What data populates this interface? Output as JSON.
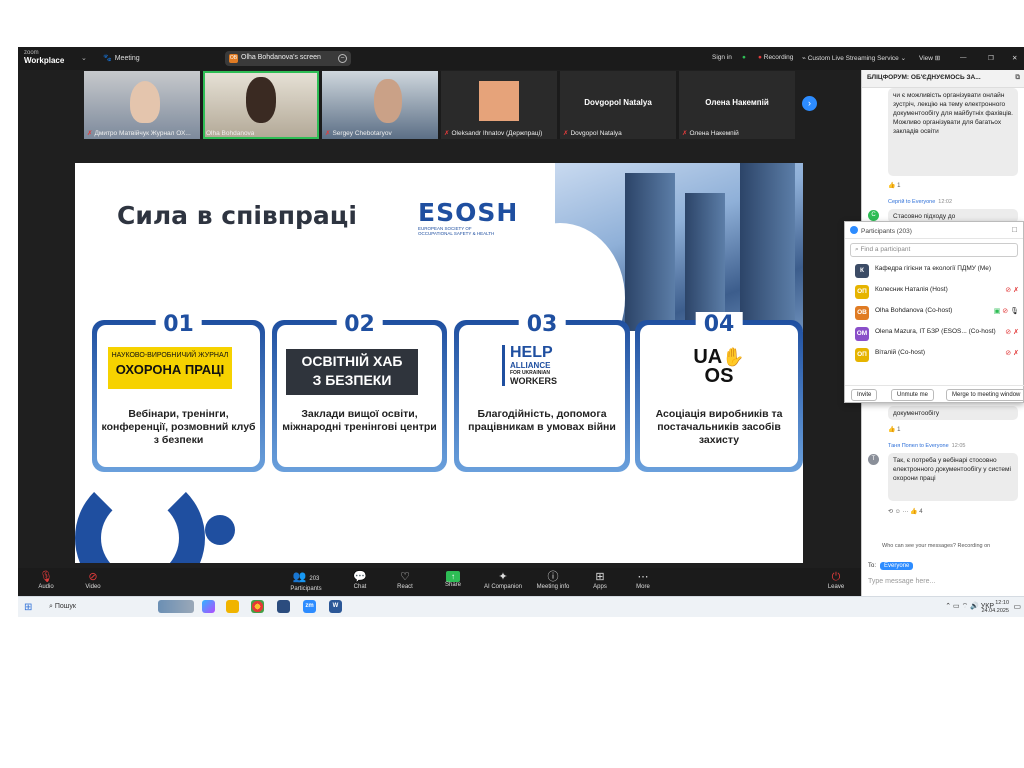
{
  "topbar": {
    "logo_line1": "zoom",
    "logo_line2": "Workplace",
    "meeting_label": "Meeting",
    "screen_avatar": "OB",
    "screen_label": "Olha Bohdanova's screen",
    "signin": "Sign in",
    "recording": "Recording",
    "streaming": "Custom Live Streaming Service",
    "view": "View"
  },
  "gallery": [
    {
      "name": "Дмитро Матвійчук Журнал ОХ...",
      "muted": true
    },
    {
      "name": "Olha Bohdanova",
      "muted": false,
      "active": true
    },
    {
      "name": "Sergey Chebotaryov",
      "muted": true
    },
    {
      "name": "Oleksandr Ihnatov (Держпраці)",
      "muted": true
    },
    {
      "name": "Dovgopol Natalya",
      "muted": true,
      "big": "Dovgopol Natalya"
    },
    {
      "name": "Олена Накемпій",
      "muted": true,
      "big": "Олена Накемпій"
    }
  ],
  "slide": {
    "title": "Сила в співпраці",
    "esosh_logo": "ESOSH",
    "esosh_sub1": "European Society of",
    "esosh_sub2": "Occupational Safety & Health",
    "cards": [
      {
        "num": "01",
        "badge_top": "НАУКОВО-ВИРОБНИЧИЙ ЖУРНАЛ",
        "badge_main": "ОХОРОНА ПРАЦІ",
        "desc": "Вебінари, тренінги, конференції, розмовний клуб з безпеки"
      },
      {
        "num": "02",
        "badge_main1": "ОСВІТНІЙ ХАБ",
        "badge_main2": "З БЕЗПЕКИ",
        "desc": "Заклади вищої освіти, міжнародні тренінгові центри"
      },
      {
        "num": "03",
        "help1": "HELP",
        "help2": "ALLIANCE",
        "help3": "FOR UKRAINIAN",
        "help4": "WORKERS",
        "desc": "Благодійність, допомога працівникам в умовах війни"
      },
      {
        "num": "04",
        "uaos1": "UA",
        "uaos2": "OS",
        "desc": "Асоціація виробників та постачальників засобів захисту"
      }
    ]
  },
  "toolbar": {
    "audio": "Audio",
    "video": "Video",
    "participants_count": "203",
    "participants": "Participants",
    "chat": "Chat",
    "react": "React",
    "share": "Share",
    "ai": "AI Companion",
    "info": "Meeting info",
    "apps": "Apps",
    "more": "More",
    "leave": "Leave"
  },
  "chat": {
    "header": "БЛІЦФОРУМ: ОБ'ЄДНУЄМОСЬ ЗА...",
    "msg1": "чи є можливість організувати онлайн зустріч, лекцію на тему електронного документообігу для майбутніх фахівців. Можливо організувати для багатьох закладів освіти",
    "react1": "👍 1",
    "sender2": "Сергій to Everyone",
    "time2": "12:02",
    "avatar2": "С",
    "msg2": "Стасовно підходу до",
    "msg3_tail": "документообігу",
    "react3": "👍 1",
    "sender4": "Таня Попел to Everyone",
    "time4": "12:05",
    "avatar4": "Т",
    "msg4": "Так, є потреба у вебінарі стосовно електронного документообігу у системі охорони праці",
    "react4": "👍 4",
    "who_can_see": "Who can see your messages? Recording on",
    "to_label": "To:",
    "to_value": "Everyone",
    "placeholder": "Type message here..."
  },
  "participants_panel": {
    "title": "Participants (203)",
    "search_placeholder": "Find a participant",
    "rows": [
      {
        "avatar": "К",
        "color": "#3c4c66",
        "name": "Кафедра гігієни та екології ПДМУ (Me)"
      },
      {
        "avatar": "ОП",
        "color": "#e6b400",
        "name": "Колесник Наталія (Host)"
      },
      {
        "avatar": "OB",
        "color": "#e07b23",
        "name": "Olha Bohdanova (Co-host)"
      },
      {
        "avatar": "OM",
        "color": "#8a4fc9",
        "name": "Olena Mazura, IT БЗР (ESOS...  (Co-host)"
      },
      {
        "avatar": "ОП",
        "color": "#e6b400",
        "name": "Віталій (Co-host)"
      }
    ],
    "invite": "Invite",
    "unmute_me": "Unmute me",
    "merge": "Merge to meeting window"
  },
  "taskbar": {
    "search": "Пошук",
    "lang": "УКР",
    "time": "12:10",
    "date": "24.04.2025"
  }
}
